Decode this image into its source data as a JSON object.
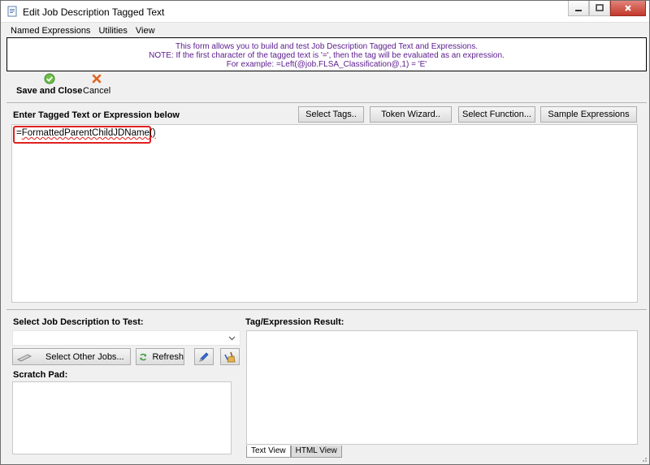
{
  "window": {
    "title": "Edit Job Description Tagged Text",
    "icon": "document-icon"
  },
  "menu": {
    "items": [
      "Named Expressions",
      "Utilities",
      "View"
    ]
  },
  "info": {
    "line1": "This form allows you to build and test Job Description Tagged Text and Expressions.",
    "line2": "NOTE: If the first character of the tagged text is '=', then the tag will be evaluated as an expression.",
    "line3": "For example: =Left(@job.FLSA_Classification@,1) = 'E'",
    "color": "#5a1a8c"
  },
  "toolbar": {
    "save_label": "Save and Close",
    "cancel_label": "Cancel"
  },
  "expression": {
    "label": "Enter Tagged Text or Expression below",
    "prefix": "=",
    "text": "FormattedParentChildJDName()",
    "buttons": {
      "select_tags": "Select Tags..",
      "token_wizard": "Token Wizard..",
      "select_function": "Select Function...",
      "sample_expressions": "Sample Expressions"
    },
    "highlight_color": "#e02020"
  },
  "job_test": {
    "label": "Select Job Description to Test:",
    "selected": "",
    "select_other_label": "Select Other Jobs...",
    "refresh_label": "Refresh"
  },
  "scratch": {
    "label": "Scratch Pad:",
    "value": ""
  },
  "result": {
    "label": "Tag/Expression Result:",
    "value": "",
    "tabs": [
      "Text View",
      "HTML View"
    ],
    "active_tab": "Text View"
  }
}
